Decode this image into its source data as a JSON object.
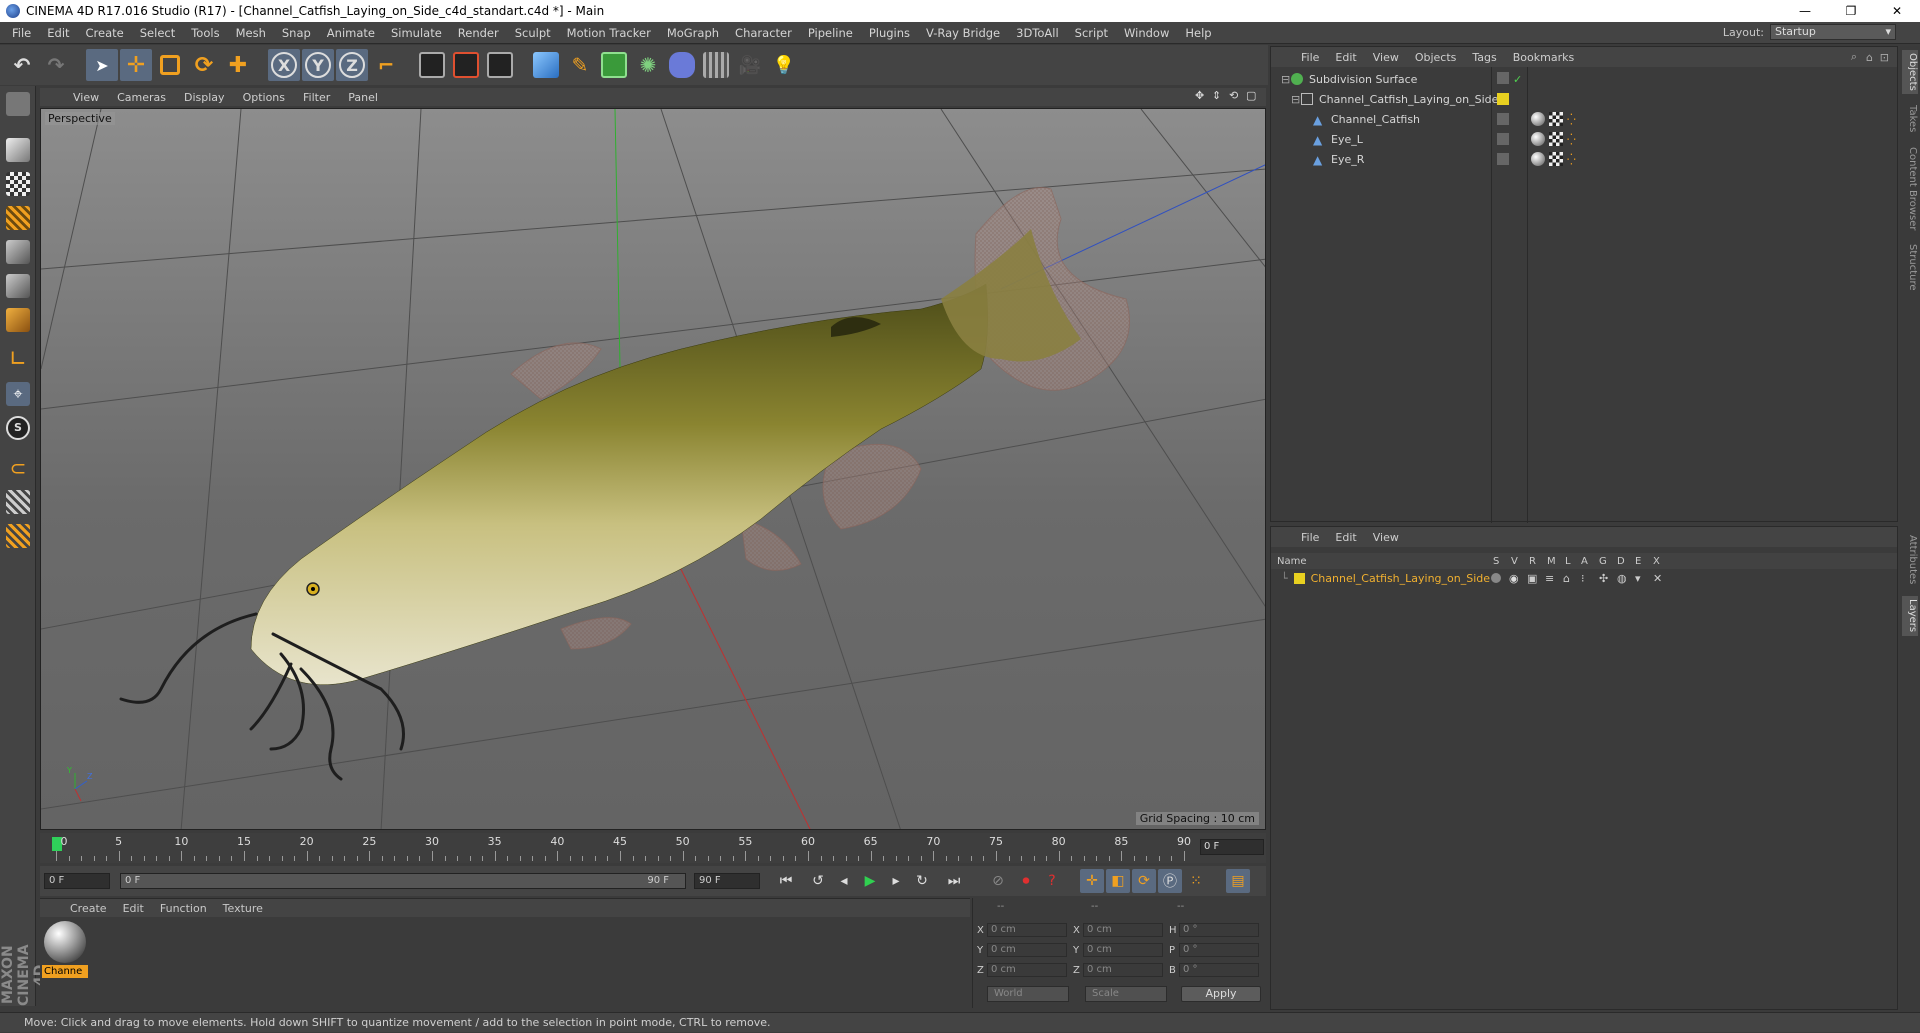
{
  "window": {
    "title": "CINEMA 4D R17.016 Studio (R17) - [Channel_Catfish_Laying_on_Side_c4d_standart.c4d *] - Main",
    "controls": [
      "—",
      "❐",
      "✕"
    ]
  },
  "menubar": {
    "items": [
      "File",
      "Edit",
      "Create",
      "Select",
      "Tools",
      "Mesh",
      "Snap",
      "Animate",
      "Simulate",
      "Render",
      "Sculpt",
      "Motion Tracker",
      "MoGraph",
      "Character",
      "Pipeline",
      "Plugins",
      "V-Ray Bridge",
      "3DToAll",
      "Script",
      "Window",
      "Help"
    ],
    "layout_label": "Layout:",
    "layout_value": "Startup"
  },
  "toolbar": {
    "axis_x": "X",
    "axis_y": "Y",
    "axis_z": "Z"
  },
  "viewport": {
    "menu": [
      "View",
      "Cameras",
      "Display",
      "Options",
      "Filter",
      "Panel"
    ],
    "label": "Perspective",
    "grid_spacing": "Grid Spacing : 10 cm",
    "axis_labels": {
      "y": "Y",
      "z": "Z"
    }
  },
  "timeline": {
    "labels": [
      "0",
      "5",
      "10",
      "15",
      "20",
      "25",
      "30",
      "35",
      "40",
      "45",
      "50",
      "55",
      "60",
      "65",
      "70",
      "75",
      "80",
      "85",
      "90"
    ],
    "current_frame": "0 F"
  },
  "transport": {
    "start_field": "0 F",
    "range_start": "0 F",
    "range_end": "90 F",
    "end_field": "90 F"
  },
  "material_manager": {
    "menu": [
      "Create",
      "Edit",
      "Function",
      "Texture"
    ],
    "material_name": "Channe"
  },
  "coordinates": {
    "headers": [
      "--",
      "--",
      "--"
    ],
    "rows": [
      {
        "l1": "X",
        "v1": "0 cm",
        "l2": "X",
        "v2": "0 cm",
        "l3": "H",
        "v3": "0 °"
      },
      {
        "l1": "Y",
        "v1": "0 cm",
        "l2": "Y",
        "v2": "0 cm",
        "l3": "P",
        "v3": "0 °"
      },
      {
        "l1": "Z",
        "v1": "0 cm",
        "l2": "Z",
        "v2": "0 cm",
        "l3": "B",
        "v3": "0 °"
      }
    ],
    "space": "World",
    "mode": "Scale",
    "apply": "Apply"
  },
  "object_manager": {
    "menu": [
      "File",
      "Edit",
      "View",
      "Objects",
      "Tags",
      "Bookmarks"
    ],
    "objects": [
      {
        "name": "Subdivision Surface",
        "indent": 0,
        "color": "#60c060"
      },
      {
        "name": "Channel_Catfish_Laying_on_Side",
        "indent": 1,
        "color": "#bbbbbb"
      },
      {
        "name": "Channel_Catfish",
        "indent": 2,
        "color": "#6aa0e0"
      },
      {
        "name": "Eye_L",
        "indent": 2,
        "color": "#6aa0e0"
      },
      {
        "name": "Eye_R",
        "indent": 2,
        "color": "#6aa0e0"
      }
    ]
  },
  "layer_manager": {
    "menu": [
      "File",
      "Edit",
      "View"
    ],
    "columns": [
      "Name",
      "S",
      "V",
      "R",
      "M",
      "L",
      "A",
      "G",
      "D",
      "E",
      "X"
    ],
    "layer_name": "Channel_Catfish_Laying_on_Side",
    "layer_color": "#e8d020"
  },
  "right_tabs": [
    "Objects",
    "Takes",
    "Content Browser",
    "Structure",
    "Attributes",
    "Layers"
  ],
  "maxon": "MAXON CINEMA 4D",
  "status": "Move: Click and drag to move elements. Hold down SHIFT to quantize movement / add to the selection in point mode, CTRL to remove."
}
